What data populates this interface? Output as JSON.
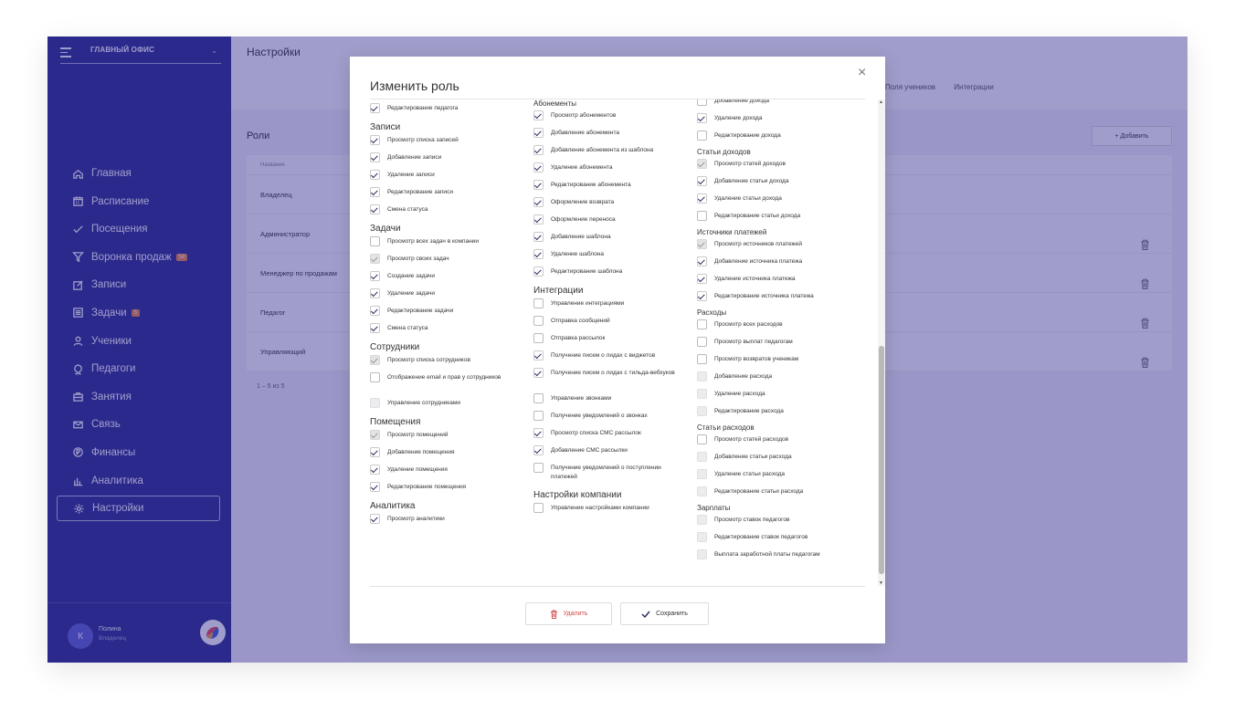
{
  "sidebar": {
    "office": "ГЛАВНЫЙ ОФИС",
    "nav": [
      {
        "label": "Главная",
        "icon": "home-icon"
      },
      {
        "label": "Расписание",
        "icon": "calendar-icon"
      },
      {
        "label": "Посещения",
        "icon": "check-icon"
      },
      {
        "label": "Воронка продаж",
        "icon": "funnel-icon",
        "badge": "58"
      },
      {
        "label": "Записи",
        "icon": "edit-icon"
      },
      {
        "label": "Задачи",
        "icon": "tasks-icon",
        "badge": "5"
      },
      {
        "label": "Ученики",
        "icon": "user-icon"
      },
      {
        "label": "Педагоги",
        "icon": "teacher-icon"
      },
      {
        "label": "Занятия",
        "icon": "briefcase-icon"
      },
      {
        "label": "Связь",
        "icon": "mail-icon"
      },
      {
        "label": "Финансы",
        "icon": "coin-icon"
      },
      {
        "label": "Аналитика",
        "icon": "bars-icon"
      },
      {
        "label": "Настройки",
        "icon": "settings-icon"
      }
    ],
    "user": {
      "initial": "К",
      "name": "Полина",
      "role": "Владелец"
    }
  },
  "main": {
    "title": "Настройки",
    "tabs": [
      "Поля учеников",
      "Интеграции"
    ],
    "roles_title": "Роли",
    "add_button": "+ Добавить",
    "table_header": "Название",
    "rows": [
      "Владелец",
      "Администратор",
      "Менеджер по продажам",
      "Педагог",
      "Управляющий"
    ],
    "pager": "1 – 5 из 5"
  },
  "modal": {
    "title": "Изменить роль",
    "close": "×",
    "delete_label": "Удалить",
    "save_label": "Сохранить",
    "columns": [
      [
        {
          "t": "c",
          "label": "Редактирование педагога",
          "s": "on"
        },
        {
          "t": "h",
          "label": "Записи"
        },
        {
          "t": "c",
          "label": "Просмотр списка записей",
          "s": "on"
        },
        {
          "t": "c",
          "label": "Добавление записи",
          "s": "on"
        },
        {
          "t": "c",
          "label": "Удаление записи",
          "s": "on"
        },
        {
          "t": "c",
          "label": "Редактирование записи",
          "s": "on"
        },
        {
          "t": "c",
          "label": "Смена статуса",
          "s": "on"
        },
        {
          "t": "h",
          "label": "Задачи"
        },
        {
          "t": "c",
          "label": "Просмотр всех задач в компании",
          "s": "off"
        },
        {
          "t": "c",
          "label": "Просмотр своих задач",
          "s": "grey"
        },
        {
          "t": "c",
          "label": "Создание задачи",
          "s": "on"
        },
        {
          "t": "c",
          "label": "Удаление задачи",
          "s": "on"
        },
        {
          "t": "c",
          "label": "Редактирование задачи",
          "s": "on"
        },
        {
          "t": "c",
          "label": "Смена статуса",
          "s": "on"
        },
        {
          "t": "h",
          "label": "Сотрудники"
        },
        {
          "t": "c",
          "label": "Просмотр списка сотрудников",
          "s": "grey"
        },
        {
          "t": "c",
          "label": "Отображение email и прав у сотрудников",
          "s": "off"
        },
        {
          "t": "c",
          "label": "Управление сотрудниками",
          "s": "dis"
        },
        {
          "t": "h",
          "label": "Помещения"
        },
        {
          "t": "c",
          "label": "Просмотр помещений",
          "s": "grey"
        },
        {
          "t": "c",
          "label": "Добавление помещения",
          "s": "on"
        },
        {
          "t": "c",
          "label": "Удаление помещения",
          "s": "on"
        },
        {
          "t": "c",
          "label": "Редактирование помещения",
          "s": "on"
        },
        {
          "t": "h",
          "label": "Аналитика"
        },
        {
          "t": "c",
          "label": "Просмотр аналитики",
          "s": "on"
        }
      ],
      [
        {
          "t": "hs",
          "label": "Абонементы"
        },
        {
          "t": "c",
          "label": "Просмотр абонементов",
          "s": "on"
        },
        {
          "t": "c",
          "label": "Добавление абонемента",
          "s": "on"
        },
        {
          "t": "c",
          "label": "Добавление абонемента из шаблона",
          "s": "on"
        },
        {
          "t": "c",
          "label": "Удаление абонемента",
          "s": "on"
        },
        {
          "t": "c",
          "label": "Редактирование абонемента",
          "s": "on"
        },
        {
          "t": "c",
          "label": "Оформление возврата",
          "s": "on"
        },
        {
          "t": "c",
          "label": "Оформление переноса",
          "s": "on"
        },
        {
          "t": "c",
          "label": "Добавление шаблона",
          "s": "on"
        },
        {
          "t": "c",
          "label": "Удаление шаблона",
          "s": "on"
        },
        {
          "t": "c",
          "label": "Редактирование шаблона",
          "s": "on"
        },
        {
          "t": "h",
          "label": "Интеграции"
        },
        {
          "t": "c",
          "label": "Управление интеграциями",
          "s": "off"
        },
        {
          "t": "c",
          "label": "Отправка сообщений",
          "s": "off"
        },
        {
          "t": "c",
          "label": "Отправка рассылок",
          "s": "off"
        },
        {
          "t": "c",
          "label": "Получение писем о лидах с виджетов",
          "s": "on"
        },
        {
          "t": "c",
          "label": "Получение писем о лидах с тильда-вебхуков",
          "s": "on"
        },
        {
          "t": "c",
          "label": "Управление звонками",
          "s": "off"
        },
        {
          "t": "c",
          "label": "Получение уведомлений о звонках",
          "s": "off"
        },
        {
          "t": "c",
          "label": "Просмотр списка СМС рассылок",
          "s": "on"
        },
        {
          "t": "c",
          "label": "Добавление СМС рассылки",
          "s": "on"
        },
        {
          "t": "c",
          "label": "Получение уведомлений о поступлении платежей",
          "s": "off"
        },
        {
          "t": "h",
          "label": "Настройки компании"
        },
        {
          "t": "c",
          "label": "Управление настройками компании",
          "s": "off"
        }
      ],
      [
        {
          "t": "c",
          "label": "Добавление дохода",
          "s": "off"
        },
        {
          "t": "c",
          "label": "Удаление дохода",
          "s": "on"
        },
        {
          "t": "c",
          "label": "Редактирование дохода",
          "s": "off"
        },
        {
          "t": "hs",
          "label": "Статьи доходов"
        },
        {
          "t": "c",
          "label": "Просмотр статей доходов",
          "s": "grey"
        },
        {
          "t": "c",
          "label": "Добавление статьи дохода",
          "s": "on"
        },
        {
          "t": "c",
          "label": "Удаление статьи дохода",
          "s": "on"
        },
        {
          "t": "c",
          "label": "Редактирование статьи дохода",
          "s": "off"
        },
        {
          "t": "hs",
          "label": "Источники платежей"
        },
        {
          "t": "c",
          "label": "Просмотр источников платежей",
          "s": "grey"
        },
        {
          "t": "c",
          "label": "Добавление источника платежа",
          "s": "on"
        },
        {
          "t": "c",
          "label": "Удаление источника платежа",
          "s": "on"
        },
        {
          "t": "c",
          "label": "Редактирование источника платежа",
          "s": "on"
        },
        {
          "t": "hs",
          "label": "Расходы"
        },
        {
          "t": "c",
          "label": "Просмотр всех расходов",
          "s": "off"
        },
        {
          "t": "c",
          "label": "Просмотр выплат педагогам",
          "s": "off"
        },
        {
          "t": "c",
          "label": "Просмотр возвратов ученикам",
          "s": "off"
        },
        {
          "t": "c",
          "label": "Добавление расхода",
          "s": "dis"
        },
        {
          "t": "c",
          "label": "Удаление расхода",
          "s": "dis"
        },
        {
          "t": "c",
          "label": "Редактирование расхода",
          "s": "dis"
        },
        {
          "t": "hs",
          "label": "Статьи расходов"
        },
        {
          "t": "c",
          "label": "Просмотр статей расходов",
          "s": "off"
        },
        {
          "t": "c",
          "label": "Добавление статьи расхода",
          "s": "dis"
        },
        {
          "t": "c",
          "label": "Удаление статьи расхода",
          "s": "dis"
        },
        {
          "t": "c",
          "label": "Редактирование статьи расхода",
          "s": "dis"
        },
        {
          "t": "hs",
          "label": "Зарплаты"
        },
        {
          "t": "c",
          "label": "Просмотр ставок педагогов",
          "s": "dis"
        },
        {
          "t": "c",
          "label": "Редактирование ставок педагогов",
          "s": "dis"
        },
        {
          "t": "c",
          "label": "Выплата заработной платы педагогам",
          "s": "dis"
        }
      ]
    ]
  },
  "colors": {
    "sidebar": "#2a2d8c",
    "overlay": "#2d268c",
    "check": "#24285f",
    "danger": "#d24a4a",
    "badge": "#f08a3e"
  }
}
